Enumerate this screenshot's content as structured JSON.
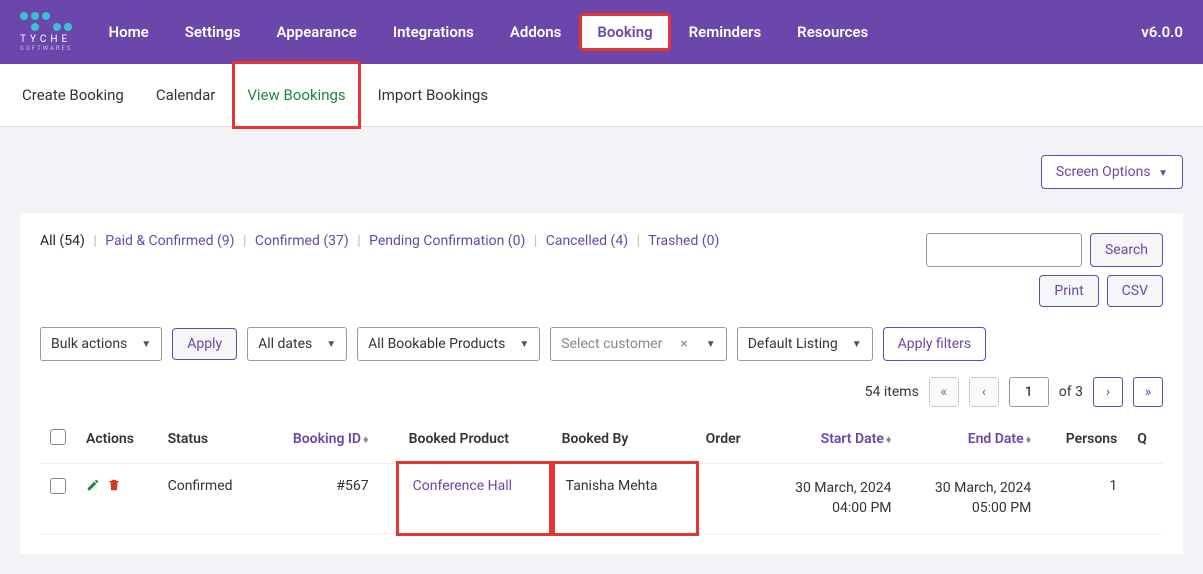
{
  "brand": {
    "name": "TYCHE",
    "subtitle": "SOFTWARES"
  },
  "version": "v6.0.0",
  "nav": {
    "items": [
      {
        "label": "Home"
      },
      {
        "label": "Settings"
      },
      {
        "label": "Appearance"
      },
      {
        "label": "Integrations"
      },
      {
        "label": "Addons"
      },
      {
        "label": "Booking",
        "active": true,
        "highlighted": true
      },
      {
        "label": "Reminders"
      },
      {
        "label": "Resources"
      }
    ]
  },
  "subnav": {
    "items": [
      {
        "label": "Create Booking"
      },
      {
        "label": "Calendar"
      },
      {
        "label": "View Bookings",
        "active": true,
        "highlighted": true
      },
      {
        "label": "Import Bookings"
      }
    ]
  },
  "screen_options_label": "Screen Options",
  "status_filters": [
    {
      "label": "All",
      "count": "54",
      "current": true
    },
    {
      "label": "Paid & Confirmed",
      "count": "9"
    },
    {
      "label": "Confirmed",
      "count": "37"
    },
    {
      "label": "Pending Confirmation",
      "count": "0"
    },
    {
      "label": "Cancelled",
      "count": "4"
    },
    {
      "label": "Trashed",
      "count": "0"
    }
  ],
  "search_label": "Search",
  "print_label": "Print",
  "csv_label": "CSV",
  "bulk": {
    "bulk_actions": "Bulk actions",
    "apply": "Apply",
    "all_dates": "All dates",
    "all_products": "All Bookable Products",
    "select_customer": "Select customer",
    "default_listing": "Default Listing",
    "apply_filters": "Apply filters"
  },
  "pager": {
    "items_text": "54 items",
    "page": "1",
    "of_text": "of 3"
  },
  "table": {
    "headers": {
      "actions": "Actions",
      "status": "Status",
      "booking_id": "Booking ID",
      "booked_product": "Booked Product",
      "booked_by": "Booked By",
      "order": "Order",
      "start_date": "Start Date",
      "end_date": "End Date",
      "persons": "Persons",
      "q": "Q"
    },
    "rows": [
      {
        "status": "Confirmed",
        "booking_id": "#567",
        "booked_product": "Conference Hall",
        "booked_by": "Tanisha Mehta",
        "order": "",
        "start_date": "30 March, 2024",
        "start_time": "04:00 PM",
        "end_date": "30 March, 2024",
        "end_time": "05:00 PM",
        "persons": "1"
      }
    ]
  }
}
